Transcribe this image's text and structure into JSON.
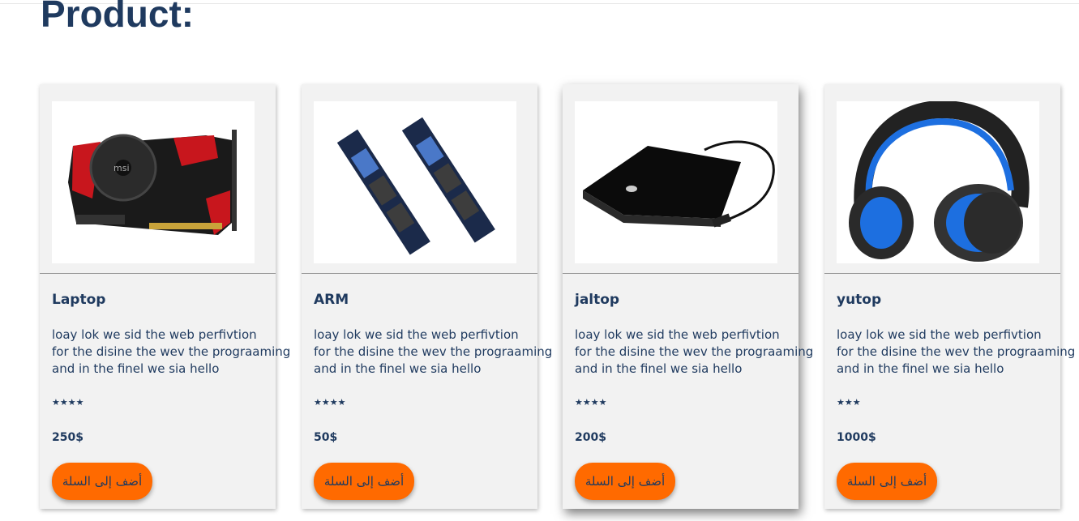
{
  "page": {
    "heading": "Product:"
  },
  "products": [
    {
      "name": "Laptop",
      "image": "graphics-card-image",
      "description": [
        "loay lok we sid the web perfivtion",
        "for the disine the wev the prograaming",
        "and in the finel we sia hello"
      ],
      "stars_text": "★★★★",
      "rating": 4,
      "price": "250$",
      "button_label": "أضف إلى السلة"
    },
    {
      "name": "ARM",
      "image": "ram-modules-image",
      "description": [
        "loay lok we sid the web perfivtion",
        "for the disine the wev the prograaming",
        "and in the finel we sia hello"
      ],
      "stars_text": "★★★★",
      "rating": 4,
      "price": "50$",
      "button_label": "أضف إلى السلة"
    },
    {
      "name": "jaltop",
      "image": "external-hard-drive-image",
      "description": [
        "loay lok we sid the web perfivtion",
        "for the disine the wev the prograaming",
        "and in the finel we sia hello"
      ],
      "stars_text": "★★★★",
      "rating": 4,
      "price": "200$",
      "button_label": "أضف إلى السلة"
    },
    {
      "name": "yutop",
      "image": "headphones-image",
      "description": [
        "loay lok we sid the web perfivtion",
        "for the disine the wev the prograaming",
        "and in the finel we sia hello"
      ],
      "stars_text": "★★★",
      "rating": 3,
      "price": "1000$",
      "button_label": "أضف إلى السلة"
    }
  ],
  "colors": {
    "heading": "#1f3a5f",
    "button": "#ff6a00",
    "card": "#f2f2f2"
  }
}
